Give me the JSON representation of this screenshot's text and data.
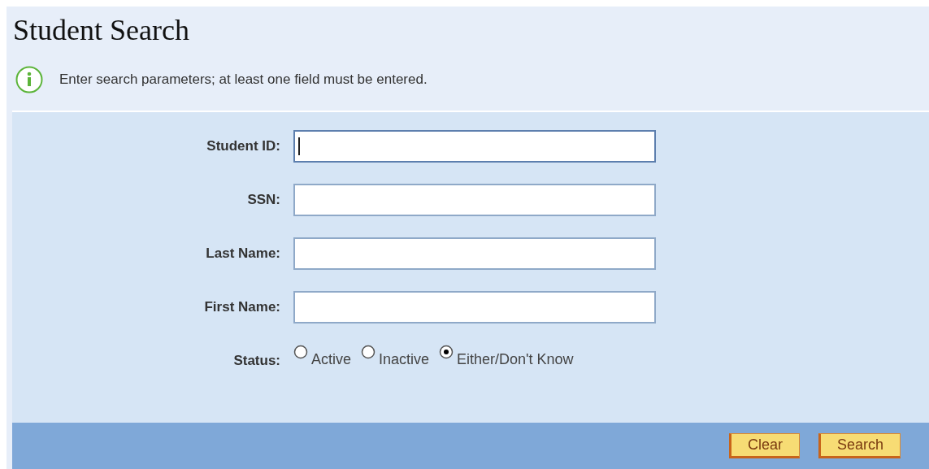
{
  "title": "Student Search",
  "info": "Enter search parameters; at least one field must be entered.",
  "fields": [
    {
      "label": "Student ID:",
      "focused": true
    },
    {
      "label": "SSN:",
      "focused": false
    },
    {
      "label": "Last Name:",
      "focused": false
    },
    {
      "label": "First Name:",
      "focused": false
    }
  ],
  "status": {
    "label": "Status:",
    "options": [
      {
        "label": "Active",
        "selected": false
      },
      {
        "label": "Inactive",
        "selected": false
      },
      {
        "label": "Either/Don't Know",
        "selected": true
      }
    ]
  },
  "buttons": [
    "Clear",
    "Search"
  ]
}
